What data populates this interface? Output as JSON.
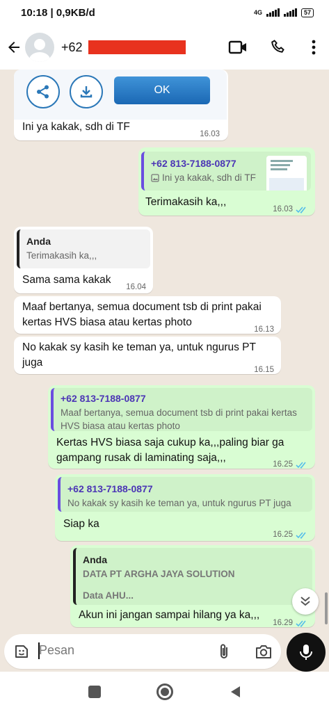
{
  "status": {
    "time_speed": "10:18 | 0,9KB/d",
    "network": "4G",
    "battery": "57"
  },
  "header": {
    "contact_prefix": "+62"
  },
  "messages": {
    "m1": {
      "text": "Ini ya kakak, sdh di TF",
      "time": "16.03",
      "button_ok": "OK"
    },
    "m2": {
      "quote_name": "+62 813-7188-0877",
      "quote_text": "Ini ya kakak, sdh di TF",
      "text": "Terimakasih ka,,,",
      "time": "16.03"
    },
    "m3": {
      "quote_name": "Anda",
      "quote_text": "Terimakasih ka,,,",
      "text": "Sama sama kakak",
      "time": "16.04"
    },
    "m4": {
      "text": "Maaf bertanya, semua document tsb di print pakai kertas HVS biasa atau kertas photo",
      "time": "16.13"
    },
    "m5": {
      "text": "No kakak sy kasih ke teman ya, untuk ngurus PT juga",
      "time": "16.15"
    },
    "m6": {
      "quote_name": "+62 813-7188-0877",
      "quote_text": "Maaf bertanya, semua document tsb di print pakai kertas HVS biasa atau kertas photo",
      "text": "Kertas HVS biasa saja cukup ka,,,paling biar ga gampang rusak di laminating saja,,,",
      "time": "16.25"
    },
    "m7": {
      "quote_name": "+62 813-7188-0877",
      "quote_text": "No kakak sy kasih ke teman ya, untuk ngurus PT juga",
      "text": "Siap ka",
      "time": "16.25"
    },
    "m8": {
      "quote_name": "Anda",
      "quote_line1": "DATA PT ARGHA JAYA SOLUTION",
      "quote_line2": "Data AHU...",
      "text": "Akun ini jangan sampai hilang ya ka,,,",
      "time": "16.29"
    }
  },
  "composer": {
    "placeholder": "Pesan"
  },
  "colors": {
    "outgoing_bubble": "#d9fdd3",
    "incoming_bubble": "#ffffff",
    "read_ticks": "#53bdeb",
    "chat_background": "#efe7de"
  }
}
